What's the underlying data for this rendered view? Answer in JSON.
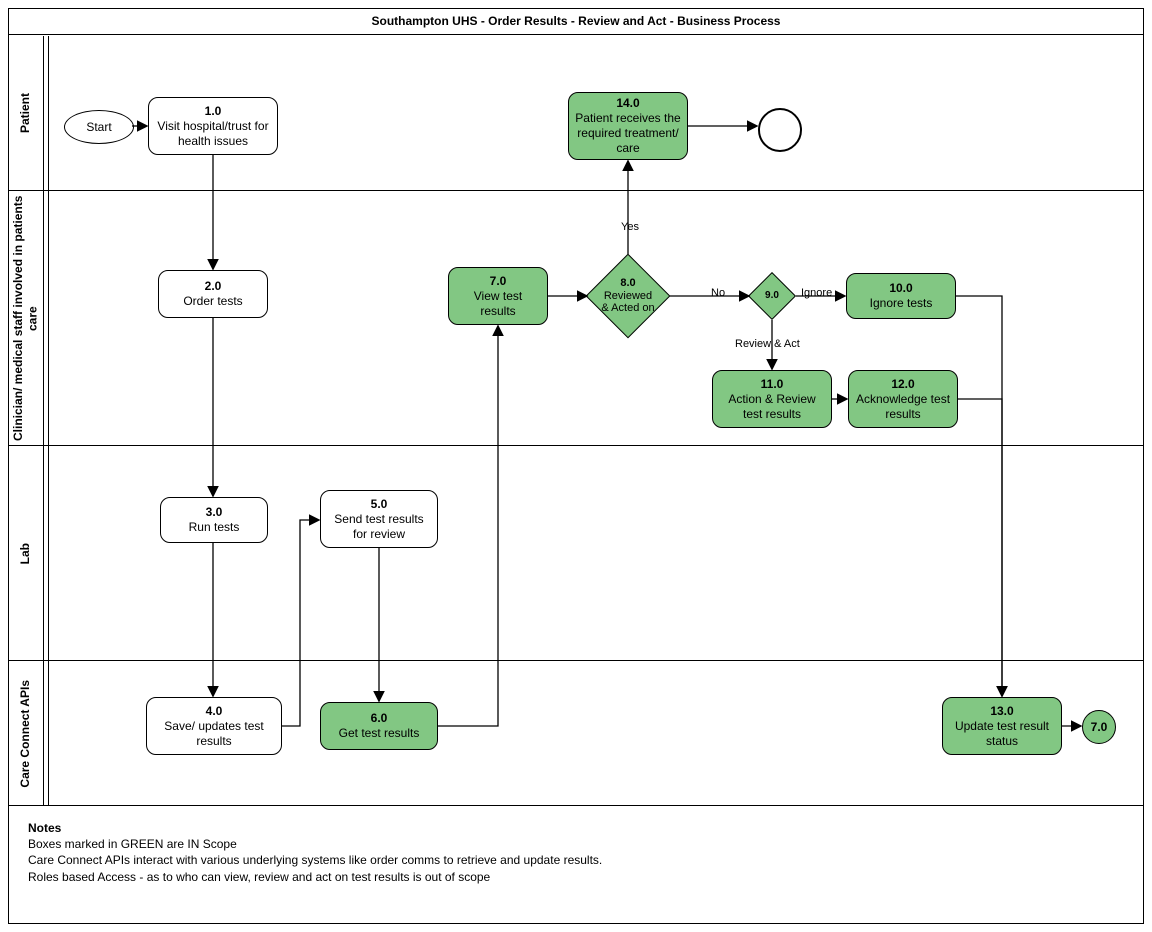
{
  "title": "Southampton UHS - Order Results - Review and Act - Business Process",
  "lanes": {
    "patient": "Patient",
    "clinician": "Clinician/ medical staff\ninvolved in patients care",
    "lab": "Lab",
    "api": "Care Connect APIs"
  },
  "start": "Start",
  "end_ref": "7.0",
  "nodes": {
    "n1": {
      "num": "1.0",
      "label": "Visit hospital/trust for health issues"
    },
    "n2": {
      "num": "2.0",
      "label": "Order tests"
    },
    "n3": {
      "num": "3.0",
      "label": "Run tests"
    },
    "n4": {
      "num": "4.0",
      "label": "Save/ updates test results"
    },
    "n5": {
      "num": "5.0",
      "label": "Send test results for review"
    },
    "n6": {
      "num": "6.0",
      "label": "Get test results"
    },
    "n7": {
      "num": "7.0",
      "label": "View test results"
    },
    "n8": {
      "num": "8.0",
      "label": "Reviewed & Acted on"
    },
    "n9": {
      "num": "9.0",
      "label": ""
    },
    "n10": {
      "num": "10.0",
      "label": "Ignore tests"
    },
    "n11": {
      "num": "11.0",
      "label": "Action & Review test results"
    },
    "n12": {
      "num": "12.0",
      "label": "Acknowledge test results"
    },
    "n13": {
      "num": "13.0",
      "label": "Update test result status"
    },
    "n14": {
      "num": "14.0",
      "label": "Patient receives the required treatment/ care"
    }
  },
  "edge_labels": {
    "yes": "Yes",
    "no": "No",
    "ignore": "Ignore",
    "review_act": "Review & Act"
  },
  "notes": {
    "heading": "Notes",
    "l1": "Boxes marked in GREEN are IN Scope",
    "l2": "Care Connect APIs interact with various  underlying systems like order comms to retrieve and update results.",
    "l3": "Roles based Access - as to who can view, review and act on test results is out of scope"
  },
  "chart_data": {
    "type": "table",
    "description": "Swimlane business process diagram. Lanes top→bottom. Green nodes are in scope.",
    "lanes": [
      "Patient",
      "Clinician/ medical staff involved in patients care",
      "Lab",
      "Care Connect APIs"
    ],
    "nodes": [
      {
        "id": "start",
        "lane": "Patient",
        "label": "Start",
        "shape": "ellipse"
      },
      {
        "id": "1.0",
        "lane": "Patient",
        "label": "Visit hospital/trust for health issues",
        "shape": "rounded"
      },
      {
        "id": "2.0",
        "lane": "Clinician",
        "label": "Order tests",
        "shape": "rounded"
      },
      {
        "id": "3.0",
        "lane": "Lab",
        "label": "Run tests",
        "shape": "rounded"
      },
      {
        "id": "4.0",
        "lane": "Care Connect APIs",
        "label": "Save/ updates test results",
        "shape": "rounded"
      },
      {
        "id": "5.0",
        "lane": "Lab",
        "label": "Send test results for review",
        "shape": "rounded"
      },
      {
        "id": "6.0",
        "lane": "Care Connect APIs",
        "label": "Get test results",
        "shape": "rounded",
        "scope": "in"
      },
      {
        "id": "7.0",
        "lane": "Clinician",
        "label": "View test results",
        "shape": "rounded",
        "scope": "in"
      },
      {
        "id": "8.0",
        "lane": "Clinician",
        "label": "Reviewed & Acted on",
        "shape": "diamond",
        "scope": "in"
      },
      {
        "id": "9.0",
        "lane": "Clinician",
        "label": "",
        "shape": "diamond",
        "scope": "in"
      },
      {
        "id": "10.0",
        "lane": "Clinician",
        "label": "Ignore tests",
        "shape": "rounded",
        "scope": "in"
      },
      {
        "id": "11.0",
        "lane": "Clinician",
        "label": "Action & Review test results",
        "shape": "rounded",
        "scope": "in"
      },
      {
        "id": "12.0",
        "lane": "Clinician",
        "label": "Acknowledge test results",
        "shape": "rounded",
        "scope": "in"
      },
      {
        "id": "13.0",
        "lane": "Care Connect APIs",
        "label": "Update test result status",
        "shape": "rounded",
        "scope": "in"
      },
      {
        "id": "14.0",
        "lane": "Patient",
        "label": "Patient receives the required treatment/ care",
        "shape": "rounded",
        "scope": "in"
      },
      {
        "id": "end",
        "lane": "Patient",
        "label": "",
        "shape": "circle"
      },
      {
        "id": "7.0-ref",
        "lane": "Care Connect APIs",
        "label": "7.0",
        "shape": "circle",
        "scope": "in"
      }
    ],
    "edges": [
      {
        "from": "start",
        "to": "1.0"
      },
      {
        "from": "1.0",
        "to": "2.0"
      },
      {
        "from": "2.0",
        "to": "3.0"
      },
      {
        "from": "3.0",
        "to": "4.0"
      },
      {
        "from": "4.0",
        "to": "5.0"
      },
      {
        "from": "5.0",
        "to": "6.0"
      },
      {
        "from": "6.0",
        "to": "7.0"
      },
      {
        "from": "7.0",
        "to": "8.0"
      },
      {
        "from": "8.0",
        "to": "14.0",
        "label": "Yes"
      },
      {
        "from": "8.0",
        "to": "9.0",
        "label": "No"
      },
      {
        "from": "9.0",
        "to": "10.0",
        "label": "Ignore"
      },
      {
        "from": "9.0",
        "to": "11.0",
        "label": "Review & Act"
      },
      {
        "from": "11.0",
        "to": "12.0"
      },
      {
        "from": "10.0",
        "to": "13.0"
      },
      {
        "from": "12.0",
        "to": "13.0"
      },
      {
        "from": "13.0",
        "to": "7.0-ref"
      },
      {
        "from": "14.0",
        "to": "end"
      }
    ]
  }
}
